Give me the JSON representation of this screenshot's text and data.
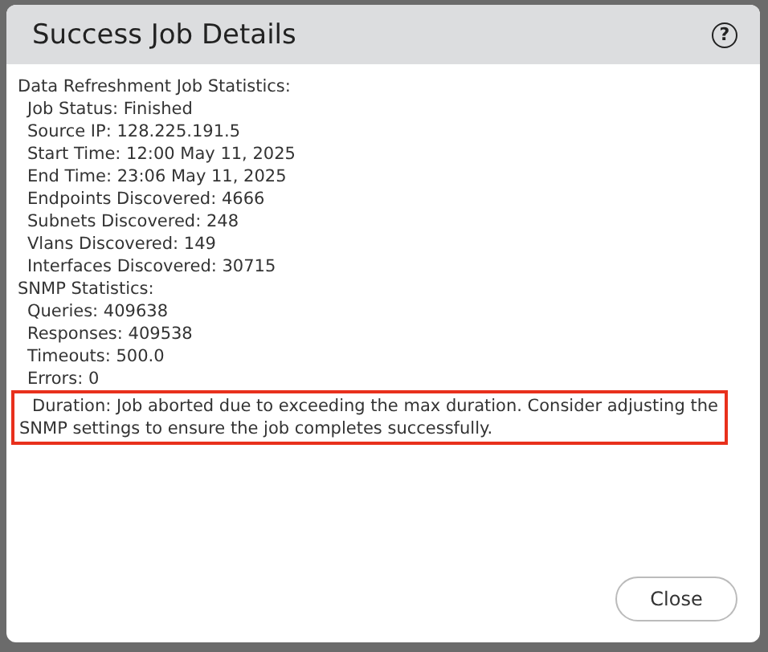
{
  "dialog": {
    "title": "Success Job Details",
    "help_icon": "?"
  },
  "sections": [
    {
      "title": "Data Refreshment Job Statistics:",
      "items": [
        "Job Status: Finished",
        "Source IP: 128.225.191.5",
        "Start Time: 12:00 May 11, 2025",
        "End Time: 23:06 May 11, 2025",
        "Endpoints Discovered: 4666",
        "Subnets Discovered: 248",
        "Vlans Discovered: 149",
        "Interfaces Discovered: 30715"
      ]
    },
    {
      "title": "SNMP Statistics:",
      "items": [
        "Queries: 409638",
        "Responses: 409538",
        "Timeouts: 500.0",
        "Errors: 0"
      ]
    }
  ],
  "note": {
    "text": "Duration: Job aborted due to exceeding the max duration. Consider adjusting the SNMP settings to ensure the job completes successfully.",
    "highlighted": true
  },
  "buttons": [
    "Close"
  ]
}
